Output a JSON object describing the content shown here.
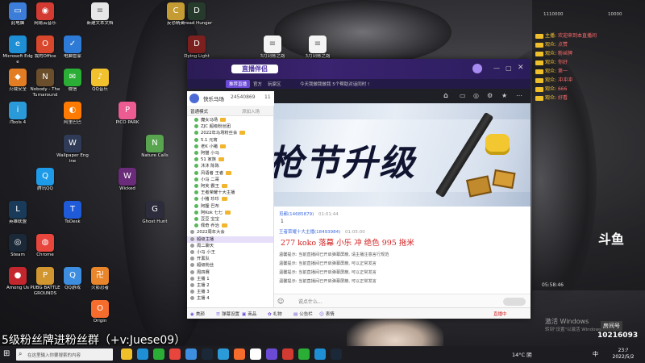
{
  "desktop_icons": [
    {
      "name": "此电脑",
      "color": "#3b7dd8",
      "glyph": "▭"
    },
    {
      "name": "网易云音乐",
      "color": "#d33a31",
      "glyph": "◉"
    },
    {
      "name": "Microsoft Edge",
      "color": "#1e8fd5",
      "glyph": "e"
    },
    {
      "name": "火绒安全",
      "color": "#e37d23",
      "glyph": "◆"
    },
    {
      "name": "iTools 4",
      "color": "#2b9ad8",
      "glyph": "i"
    },
    {
      "name": "我的Office",
      "color": "#d8472b",
      "glyph": "O"
    },
    {
      "name": "电脑管家",
      "color": "#2d7bd6",
      "glyph": "✓"
    },
    {
      "name": "微信",
      "color": "#2bae36",
      "glyph": "✉"
    },
    {
      "name": "Steam",
      "color": "#1b2838",
      "glyph": "◎"
    },
    {
      "name": "Among Us",
      "color": "#c4262e",
      "glyph": "●"
    },
    {
      "name": "火影忍者",
      "color": "#e9852b",
      "glyph": "卍"
    },
    {
      "name": "阿里巴巴",
      "color": "#ff7a00",
      "glyph": "◐"
    },
    {
      "name": "Nobody - The Turnaround",
      "color": "#6b4e2b",
      "glyph": "N"
    },
    {
      "name": "腾讯QQ",
      "color": "#1d9be8",
      "glyph": "Q"
    },
    {
      "name": "QQ游戏",
      "color": "#3d8ee1",
      "glyph": "Q"
    },
    {
      "name": "英雄联盟",
      "color": "#1a3a5a",
      "glyph": "L"
    },
    {
      "name": "PUBG BATTLEGROUNDS",
      "color": "#d1962f",
      "glyph": "P"
    },
    {
      "name": "ToDesk",
      "color": "#1f5ad8",
      "glyph": "T"
    },
    {
      "name": "Origin",
      "color": "#f56c2d",
      "glyph": "O"
    },
    {
      "name": "Wallpaper Engine",
      "color": "#2f3b56",
      "glyph": "W"
    },
    {
      "name": "QQ音乐",
      "color": "#f2c12e",
      "glyph": "♪"
    },
    {
      "name": "Chrome",
      "color": "#e8453c",
      "glyph": "◍"
    },
    {
      "name": "Wicked",
      "color": "#6a2b7b",
      "glyph": "W"
    },
    {
      "name": "PICO PARK",
      "color": "#ec5c92",
      "glyph": "P"
    },
    {
      "name": "Ghost Hunt",
      "color": "#2c2c3c",
      "glyph": "G"
    },
    {
      "name": "Nature Calls",
      "color": "#58a44f",
      "glyph": "N"
    },
    {
      "name": "新建文本文档",
      "color": "#e6e6e6",
      "glyph": "≡"
    },
    {
      "name": "3月到账之路",
      "color": "#f4f4f4",
      "glyph": "≡"
    },
    {
      "name": "3月到账之路",
      "color": "#f4f4f4",
      "glyph": "≡"
    },
    {
      "name": "Dying Light",
      "color": "#7c1f1f",
      "glyph": "D"
    },
    {
      "name": "Dread Hunger",
      "color": "#263b2c",
      "glyph": "D"
    },
    {
      "name": "反恐精英",
      "color": "#c59b34",
      "glyph": "C"
    }
  ],
  "app": {
    "logo": "直播伴侣",
    "tabs": [
      "推荐直播",
      "官方",
      "玩家区",
      "今天我做我做我 5个帮助对话同时 !"
    ],
    "room": {
      "title": "快乐马场",
      "id": "24540869",
      "count": "11"
    },
    "left_header": "普通模式",
    "left_add": "添加入场",
    "left_items": [
      "魔女马场",
      "ZJC 超级粉丝团",
      "2022年马场粉丝会",
      "5.1 元宵",
      "老K 小猪",
      "阿猫 小马",
      "51 家族",
      "沐沐 陈陈",
      "风语者 王者",
      "小马 二哥",
      "阿芙 霸王",
      "王者荣耀十大主播",
      "小猪 珍珍",
      "阿狸 巴布",
      "阿Kok 七七",
      "豆豆 宝宝",
      "佩奇 乔治",
      "2022周年大会",
      "超级主播",
      "周二聊天",
      "小马 小王",
      "开黑队",
      "超级粉丝",
      "周四赛",
      "主播 1",
      "主播 2",
      "主播 3",
      "主播 4"
    ],
    "banner_text": "枪节升级",
    "chat": {
      "line1_user": "觅都(14685879)",
      "line1_time": "01:01:44",
      "line1_text": "1",
      "line2_user": "王者荣耀十大主播(18493984)",
      "line2_time": "01:05:00",
      "highlight": "277 koko 落幕 小乐 冲 绝色 995 拖米",
      "system_msgs": [
        "温馨提示: 当前直播间已开启弹幕屏蔽, 请主播注意言行规范",
        "温馨提示: 当前直播间已开启弹幕屏蔽, 可以正常发言",
        "温馨提示: 当前直播间已开启弹幕屏蔽, 可以正常发言",
        "温馨提示: 当前直播间已开启弹幕屏蔽, 可以正常发言"
      ],
      "input_placeholder": "说点什么..."
    },
    "bottom_items": [
      "美颜",
      "弹幕设置",
      "商品",
      "礼物",
      "公告栏",
      "表情"
    ],
    "bottom_right": "直播中"
  },
  "right_chat": {
    "top": [
      "1110000",
      "10000"
    ],
    "lines": [
      {
        "user": "主播",
        "text": "欢迎来到本直播间"
      },
      {
        "user": "观众",
        "text": "点赞"
      },
      {
        "user": "观众",
        "text": "粉丝牌"
      },
      {
        "user": "观众",
        "text": "你好"
      },
      {
        "user": "观众",
        "text": "第一"
      },
      {
        "user": "观众",
        "text": "冲冲冲"
      },
      {
        "user": "观众",
        "text": "666"
      },
      {
        "user": "观众",
        "text": "好看"
      }
    ],
    "live_time": "05:58:46"
  },
  "overlay_text": "5级粉丝牌进粉丝群（+v:Juese09）",
  "watermark_line1": "激活 Windows",
  "watermark_line2": "转到\"设置\"以激活 Windows。",
  "douyu_logo": "斗鱼",
  "room_number_label": "房间号",
  "room_number": "10216093",
  "taskbar": {
    "search_placeholder": "在这里输入你要搜索的内容",
    "temp": "14°C",
    "weather": "阴",
    "time": "23:?",
    "date": "2022/5/2",
    "lang": "中"
  },
  "colors": {
    "accent": "#6b4bd6",
    "highlight": "#d31f1f",
    "taskbar": "#1c1c22"
  }
}
